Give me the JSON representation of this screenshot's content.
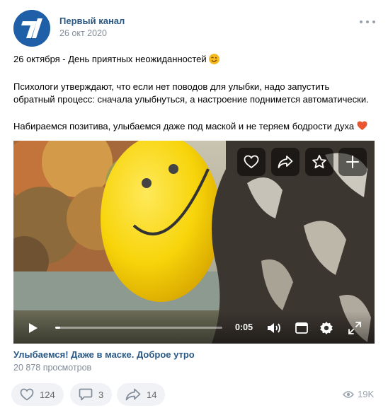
{
  "post": {
    "author": "Первый канал",
    "date": "26 окт 2020",
    "lines": [
      "26 октября - День приятных неожиданностей",
      "Психологи утверждают, что если нет поводов для улыбки, надо запустить",
      "обратный процесс: сначала улыбнуться, а настроение поднимется автоматически.",
      "Набираемся позитива, улыбаемся даже под маской и не теряем бодрости духа"
    ]
  },
  "video": {
    "time": "0:05",
    "progress": 0.03,
    "title": "Улыбаемся! Даже в маске. Доброе утро",
    "views_text": "20 878 просмотров"
  },
  "footer": {
    "likes": "124",
    "comments": "3",
    "shares": "14",
    "views": "19K"
  },
  "colors": {
    "link": "#2a5885",
    "muted": "#818c99",
    "pill_bg": "#f0f2f5",
    "heart": "#e8552f"
  },
  "icons": [
    "channel-one-logo",
    "more-icon",
    "wink-emoji",
    "heart-emoji",
    "heart-icon",
    "share-icon",
    "star-icon",
    "plus-icon",
    "play-icon",
    "volume-icon",
    "miniplayer-icon",
    "settings-icon",
    "fullscreen-icon",
    "like-icon",
    "comment-icon",
    "share-icon",
    "eye-icon"
  ]
}
